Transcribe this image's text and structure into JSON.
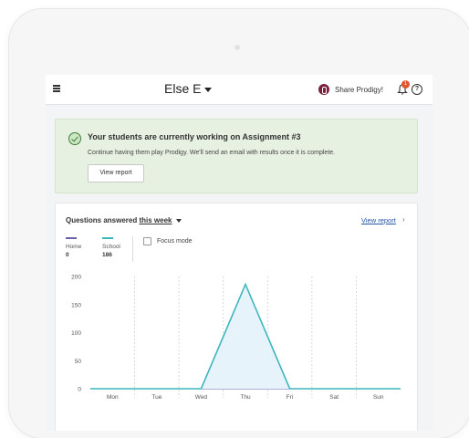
{
  "header": {
    "class_name": "Else E",
    "share_label": "Share Prodigy!",
    "notification_count": "1",
    "help_glyph": "?"
  },
  "banner": {
    "title": "Your students are currently working on Assignment #3",
    "message": "Continue having them play Prodigy. We'll send an email with results once it is complete.",
    "button_label": "View report"
  },
  "report": {
    "title_prefix": "Questions answered",
    "period": "this week",
    "view_link": "View report",
    "legend": [
      {
        "name": "Home",
        "value": "0",
        "color": "#6a5fa8"
      },
      {
        "name": "School",
        "value": "186",
        "color": "#3db5bd"
      }
    ],
    "focus_mode_label": "Focus mode"
  },
  "chart_data": {
    "type": "area",
    "categories": [
      "Mon",
      "Tue",
      "Wed",
      "Thu",
      "Fri",
      "Sat",
      "Sun"
    ],
    "yticks": [
      0,
      50,
      100,
      150,
      200
    ],
    "ylim": [
      0,
      200
    ],
    "series": [
      {
        "name": "Home",
        "values": [
          0,
          0,
          0,
          0,
          0,
          0,
          0
        ],
        "color": "#6a5fa8"
      },
      {
        "name": "School",
        "values": [
          0,
          0,
          0,
          186,
          0,
          0,
          0
        ],
        "color": "#3db5bd",
        "fill": "#e6f3fb"
      }
    ],
    "grid": "vertical dashed"
  }
}
